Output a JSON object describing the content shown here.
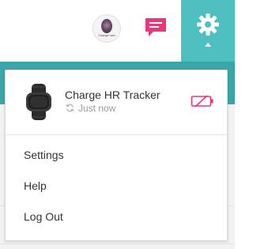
{
  "header": {
    "avatar_caption": "Change user",
    "messages_icon": "chat-bubble-icon",
    "settings_icon": "gear-icon",
    "colors": {
      "teal_dark": "#3aa6a8",
      "teal_light": "#4fc0c0",
      "pink": "#e8377a"
    }
  },
  "dropdown": {
    "device": {
      "name": "Charge HR Tracker",
      "sync_status": "Just now",
      "battery_icon": "battery-low-icon"
    },
    "menu": [
      {
        "label": "Settings"
      },
      {
        "label": "Help"
      },
      {
        "label": "Log Out"
      }
    ]
  }
}
